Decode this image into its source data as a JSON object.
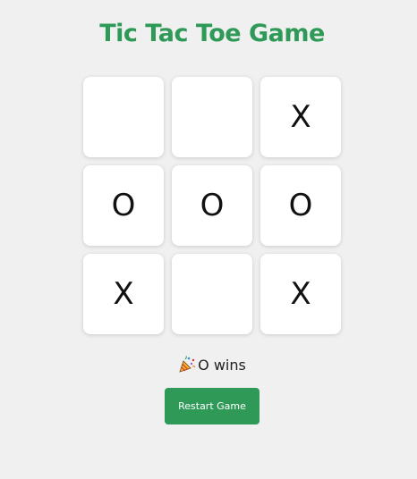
{
  "title": "Tic Tac Toe Game",
  "board": {
    "cells": [
      "",
      "",
      "X",
      "O",
      "O",
      "O",
      "X",
      "",
      "X"
    ]
  },
  "status": {
    "icon": "party-popper-icon",
    "text": "O wins"
  },
  "restart_label": "Restart Game",
  "colors": {
    "accent": "#2f9a58",
    "background": "#f0f0f0",
    "cell": "#ffffff"
  }
}
